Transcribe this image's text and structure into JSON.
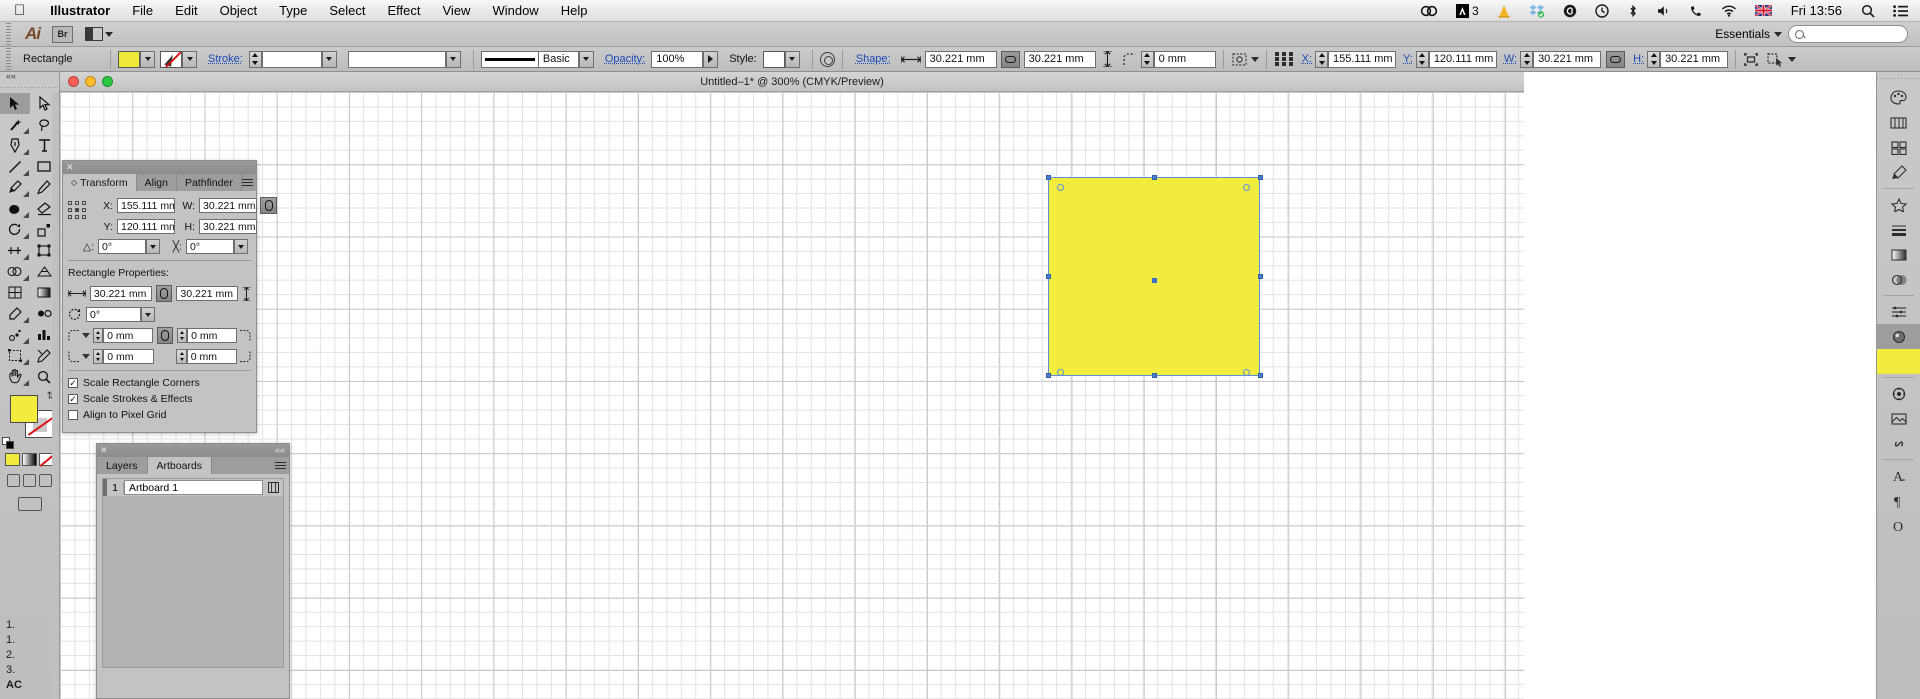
{
  "macbar": {
    "apple_icon": "apple-icon",
    "app_name": "Illustrator",
    "menus": [
      "File",
      "Edit",
      "Object",
      "Type",
      "Select",
      "Effect",
      "View",
      "Window",
      "Help"
    ],
    "status_icons": [
      "creative-cloud-icon",
      "adobe-a-icon",
      "traffic-cone-icon",
      "dropbox-icon",
      "at-symbol-icon",
      "time-machine-icon",
      "bluetooth-icon",
      "volume-icon",
      "phone-icon",
      "wifi-icon",
      "uk-flag-icon"
    ],
    "adobe_badge_count": "3",
    "clock": "Fri 13:56",
    "spotlight_icon": "search-icon",
    "notification_icon": "notification-center-icon"
  },
  "appbar": {
    "logo": "Ai",
    "bridge_label": "Br",
    "arrange_icon": "arrange-documents-icon",
    "workspace": "Essentials",
    "search_placeholder": ""
  },
  "controlbar": {
    "object_type": "Rectangle",
    "fill_swatch_color": "#f0e93c",
    "fill_label": "fill-swatch",
    "stroke_swatch_label": "stroke-swatch-none",
    "stroke_label": "Stroke:",
    "stroke_weight": "",
    "stroke_profile": "",
    "brush_label": "Basic",
    "opacity_label": "Opacity:",
    "opacity_value": "100%",
    "style_label": "Style:",
    "shape_label": "Shape:",
    "shape_width": "30.221 mm",
    "shape_height": "30.221 mm",
    "corner_radius": "0 mm",
    "x_label": "X:",
    "x_value": "155.111 mm",
    "y_label": "Y:",
    "y_value": "120.111 mm",
    "w_label": "W:",
    "w_value": "30.221 mm",
    "h_label": "H:",
    "h_value": "30.221 mm"
  },
  "document": {
    "title": "Untitled–1* @ 300% (CMYK/Preview)"
  },
  "transform_panel": {
    "tabs": [
      {
        "label": "Transform",
        "active": true
      },
      {
        "label": "Align",
        "active": false
      },
      {
        "label": "Pathfinder",
        "active": false
      }
    ],
    "x_label": "X:",
    "x_value": "155.111 mm",
    "w_label": "W:",
    "w_value": "30.221 mm",
    "y_label": "Y:",
    "y_value": "120.111 mm",
    "h_label": "H:",
    "h_value": "30.221 mm",
    "rotate_value": "0°",
    "shear_value": "0°",
    "section_title": "Rectangle Properties:",
    "rect_width": "30.221 mm",
    "rect_height": "30.221 mm",
    "rect_angle": "0°",
    "corner_tl": "0 mm",
    "corner_tr": "0 mm",
    "corner_bl": "0 mm",
    "corner_br": "0 mm",
    "checkboxes": [
      {
        "label": "Scale Rectangle Corners",
        "checked": true
      },
      {
        "label": "Scale Strokes & Effects",
        "checked": true
      },
      {
        "label": "Align to Pixel Grid",
        "checked": false
      }
    ]
  },
  "layers_panel": {
    "tabs": [
      {
        "label": "Layers",
        "active": false
      },
      {
        "label": "Artboards",
        "active": true
      }
    ],
    "rows": [
      {
        "num": "1",
        "name": "Artboard 1"
      }
    ]
  },
  "artwork": {
    "fill_color": "#f2ec3e",
    "selection_color": "#5a8fe0"
  },
  "toolbar": {
    "tools": [
      "selection-tool",
      "direct-selection-tool",
      "magic-wand-tool",
      "lasso-tool",
      "pen-tool",
      "type-tool",
      "line-segment-tool",
      "rectangle-tool",
      "paintbrush-tool",
      "pencil-tool",
      "blob-brush-tool",
      "eraser-tool",
      "rotate-tool",
      "scale-tool",
      "width-tool",
      "free-transform-tool",
      "shape-builder-tool",
      "perspective-grid-tool",
      "mesh-tool",
      "gradient-tool",
      "eyedropper-tool",
      "blend-tool",
      "symbol-sprayer-tool",
      "column-graph-tool",
      "artboard-tool",
      "slice-tool",
      "hand-tool",
      "zoom-tool"
    ],
    "fill_color": "#f2ec3e",
    "stroke_color": "#ffffff"
  },
  "right_dock": {
    "items": [
      "color-panel-icon",
      "color-guide-icon",
      "swatches-panel-icon",
      "brushes-panel-icon",
      "symbols-panel-icon",
      "stroke-panel-icon",
      "gradient-panel-icon",
      "transparency-panel-icon",
      "appearance-panel-icon",
      "graphic-styles-icon",
      "character-panel-icon",
      "paragraph-panel-icon",
      "opentype-panel-icon"
    ]
  },
  "seq_numbers": [
    "1.",
    "1.",
    "2.",
    "3.",
    "AC"
  ]
}
